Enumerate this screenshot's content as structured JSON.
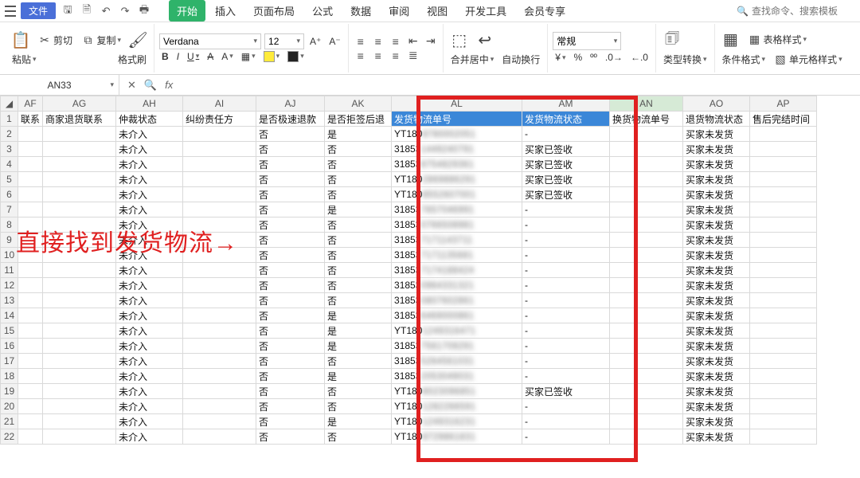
{
  "menu": {
    "file": "文件",
    "tabs": [
      "开始",
      "插入",
      "页面布局",
      "公式",
      "数据",
      "审阅",
      "视图",
      "开发工具",
      "会员专享"
    ],
    "active_tab": 0,
    "search_placeholder": "查找命令、搜索模板"
  },
  "ribbon": {
    "paste": "粘贴",
    "cut": "剪切",
    "copy": "复制",
    "format_painter": "格式刷",
    "font_name": "Verdana",
    "font_size": "12",
    "merge": "合并居中",
    "wrap": "自动换行",
    "num_format": "常规",
    "type_convert": "类型转换",
    "cond_fmt": "条件格式",
    "table_style": "表格样式",
    "cell_style": "单元格样式"
  },
  "namebox": {
    "cell": "AN33",
    "fx": "fx"
  },
  "columns": [
    "AF",
    "AG",
    "AH",
    "AI",
    "AJ",
    "AK",
    "AL",
    "AM",
    "AN",
    "AO",
    "AP"
  ],
  "header_row": {
    "AF": "联系",
    "AG": "商家退货联系",
    "AH": "仲裁状态",
    "AI": "纠纷责任方",
    "AJ": "是否极速退款",
    "AK": "是否拒签后退",
    "AL": "发货物流单号",
    "AM": "发货物流状态",
    "AN": "换货物流单号",
    "AO": "退货物流状态",
    "AP": "售后完结时间"
  },
  "rows": [
    {
      "AH": "未介入",
      "AJ": "否",
      "AK": "是",
      "AL_a": "YT180",
      "AL_b": "8780002051",
      "AM": "-",
      "AO": "买家未发货"
    },
    {
      "AH": "未介入",
      "AJ": "否",
      "AK": "否",
      "AL_a": "31853",
      "AL_b": "1449240791",
      "AM": "买家已签收",
      "AO": "买家未发货"
    },
    {
      "AH": "未介入",
      "AJ": "否",
      "AK": "否",
      "AL_a": "31853",
      "AL_b": "8754829361",
      "AM": "买家已签收",
      "AO": "买家未发货"
    },
    {
      "AH": "未介入",
      "AJ": "否",
      "AK": "否",
      "AL_a": "YT180",
      "AL_b": "2869886291",
      "AM": "买家已签收",
      "AO": "买家未发货"
    },
    {
      "AH": "未介入",
      "AJ": "否",
      "AK": "否",
      "AL_a": "YT180",
      "AL_b": "8552607001",
      "AM": "买家已签收",
      "AO": "买家未发货"
    },
    {
      "AH": "未介入",
      "AJ": "否",
      "AK": "是",
      "AL_a": "31853",
      "AL_b": "7657046991",
      "AM": "-",
      "AO": "买家未发货"
    },
    {
      "AH": "未介入",
      "AJ": "否",
      "AK": "否",
      "AL_a": "31853",
      "AL_b": "0766508981",
      "AM": "-",
      "AO": "买家未发货"
    },
    {
      "AH": "未介入",
      "AJ": "否",
      "AK": "否",
      "AL_a": "31853",
      "AL_b": "7171143711",
      "AM": "-",
      "AO": "买家未发货"
    },
    {
      "AH": "未介入",
      "AJ": "否",
      "AK": "否",
      "AL_a": "31853",
      "AL_b": "7171135681",
      "AM": "-",
      "AO": "买家未发货"
    },
    {
      "AH": "未介入",
      "AJ": "否",
      "AK": "否",
      "AL_a": "31853",
      "AL_b": "7174188424",
      "AM": "-",
      "AO": "买家未发货"
    },
    {
      "AH": "未介入",
      "AJ": "否",
      "AK": "否",
      "AL_a": "31853",
      "AL_b": "0964331321",
      "AM": "-",
      "AO": "买家未发货"
    },
    {
      "AH": "未介入",
      "AJ": "否",
      "AK": "否",
      "AL_a": "31853",
      "AL_b": "0807602861",
      "AM": "-",
      "AO": "买家未发货"
    },
    {
      "AH": "未介入",
      "AJ": "否",
      "AK": "是",
      "AL_a": "31853",
      "AL_b": "6469000861",
      "AM": "-",
      "AO": "买家未发货"
    },
    {
      "AH": "未介入",
      "AJ": "否",
      "AK": "是",
      "AL_a": "YT180",
      "AL_b": "1249316471",
      "AM": "-",
      "AO": "买家未发货"
    },
    {
      "AH": "未介入",
      "AJ": "否",
      "AK": "是",
      "AL_a": "31853",
      "AL_b": "7561709291",
      "AM": "-",
      "AO": "买家未发货"
    },
    {
      "AH": "未介入",
      "AJ": "否",
      "AK": "否",
      "AL_a": "31853",
      "AL_b": "5264561031",
      "AM": "-",
      "AO": "买家未发货"
    },
    {
      "AH": "未介入",
      "AJ": "否",
      "AK": "是",
      "AL_a": "31853",
      "AL_b": "2053049031",
      "AM": "-",
      "AO": "买家未发货"
    },
    {
      "AH": "未介入",
      "AJ": "否",
      "AK": "否",
      "AL_a": "YT180",
      "AL_b": "8023096851",
      "AM": "买家已签收",
      "AO": "买家未发货"
    },
    {
      "AH": "未介入",
      "AJ": "否",
      "AK": "否",
      "AL_a": "YT180",
      "AL_b": "1282266591",
      "AM": "-",
      "AO": "买家未发货"
    },
    {
      "AH": "未介入",
      "AJ": "否",
      "AK": "是",
      "AL_a": "YT180",
      "AL_b": "1249316231",
      "AM": "-",
      "AO": "买家未发货"
    },
    {
      "AH": "未介入",
      "AJ": "否",
      "AK": "否",
      "AL_a": "YT180",
      "AL_b": "8729861831",
      "AM": "-",
      "AO": "买家未发货"
    }
  ],
  "annotation": "直接找到发货物流→"
}
